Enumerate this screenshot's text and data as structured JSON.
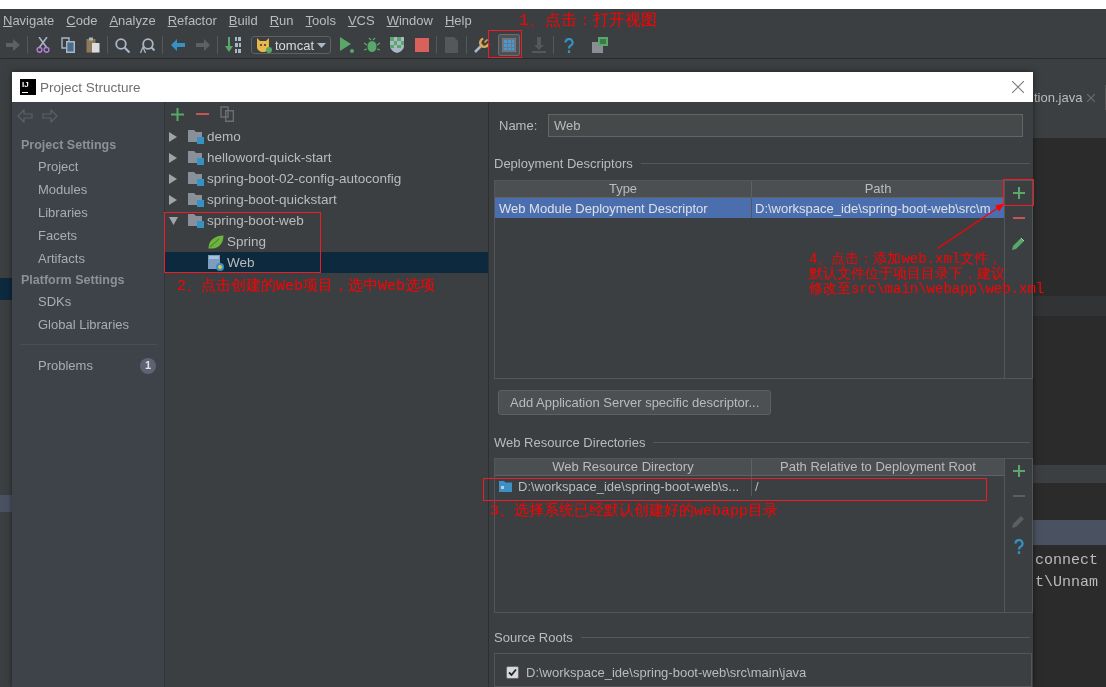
{
  "menu_bar": {
    "items": [
      "Navigate",
      "Code",
      "Analyze",
      "Refactor",
      "Build",
      "Run",
      "Tools",
      "VCS",
      "Window",
      "Help"
    ]
  },
  "toolbar": {
    "run_configuration": "tomcat",
    "annotation": "1、点击：打开视图"
  },
  "editor": {
    "tab": "tion.java",
    "console_lines": [
      "connect",
      "t\\Unnam"
    ]
  },
  "dialog": {
    "logo": "IJ",
    "title": "Project Structure"
  },
  "sidebar": {
    "sections": [
      {
        "title": "Project Settings",
        "items": [
          {
            "label": "Project",
            "selected": false
          },
          {
            "label": "Modules",
            "selected": false
          },
          {
            "label": "Libraries",
            "selected": false
          },
          {
            "label": "Facets",
            "selected": false
          },
          {
            "label": "Artifacts",
            "selected": false
          }
        ]
      },
      {
        "title": "Platform Settings",
        "items": [
          {
            "label": "SDKs",
            "selected": false
          },
          {
            "label": "Global Libraries",
            "selected": false
          }
        ]
      }
    ],
    "problems": {
      "label": "Problems",
      "count": "1",
      "selected": false
    }
  },
  "modules_tree": {
    "items": [
      {
        "label": "demo",
        "kind": "module",
        "expanded": false,
        "selected": false
      },
      {
        "label": "helloword-quick-start",
        "kind": "module",
        "expanded": false,
        "selected": false
      },
      {
        "label": "spring-boot-02-config-autoconfig",
        "kind": "module",
        "expanded": false,
        "selected": false
      },
      {
        "label": "spring-boot-quickstart",
        "kind": "module",
        "expanded": false,
        "selected": false
      },
      {
        "label": "spring-boot-web",
        "kind": "module",
        "expanded": true,
        "selected": false,
        "children": [
          {
            "label": "Spring",
            "kind": "spring",
            "selected": false
          },
          {
            "label": "Web",
            "kind": "web",
            "selected": true
          }
        ]
      }
    ],
    "annotation": "2、点击创建的Web项目，选中Web选项"
  },
  "facet_editor": {
    "name_label": "Name:",
    "name_value": "Web",
    "deployment_descriptors": {
      "title": "Deployment Descriptors",
      "columns": [
        "Type",
        "Path"
      ],
      "rows": [
        {
          "cells": [
            "Web Module Deployment Descriptor",
            "D:\\workspace_ide\\spring-boot-web\\src\\m"
          ],
          "selected": true
        }
      ],
      "tools": [
        {
          "kind": "add",
          "disabled": false
        },
        {
          "kind": "remove",
          "disabled": false
        },
        {
          "kind": "edit",
          "disabled": false
        }
      ],
      "annotation": [
        "4、点击：添加web.xml文件，",
        "默认文件位于项目目录下，建议",
        "修改至src\\main\\webapp\\web.xml"
      ]
    },
    "add_descriptor_button": "Add Application Server specific descriptor...",
    "web_resource_directories": {
      "title": "Web Resource Directories",
      "columns": [
        "Web Resource Directory",
        "Path Relative to Deployment Root"
      ],
      "rows": [
        {
          "cells": [
            "D:\\workspace_ide\\spring-boot-web\\s...",
            "/"
          ],
          "selected": false
        }
      ],
      "tools": [
        {
          "kind": "add",
          "disabled": false
        },
        {
          "kind": "remove",
          "disabled": true
        },
        {
          "kind": "edit",
          "disabled": true
        },
        {
          "kind": "help",
          "disabled": false
        }
      ],
      "annotation": "3、选择系统已经默认创建好的webapp目录"
    },
    "source_roots": {
      "title": "Source Roots",
      "items": [
        {
          "path": "D:\\workspace_ide\\spring-boot-web\\src\\main\\java",
          "checked": true
        }
      ]
    }
  }
}
